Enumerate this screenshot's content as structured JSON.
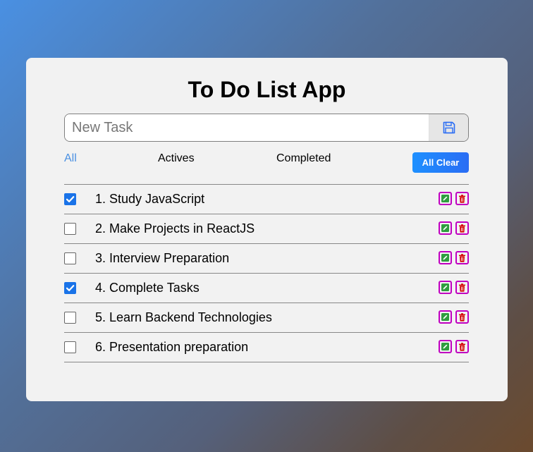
{
  "app": {
    "title": "To Do List App"
  },
  "new_task": {
    "placeholder": "New Task",
    "value": "",
    "save_icon": "floppy-disk-icon"
  },
  "filters": {
    "all": "All",
    "actives": "Actives",
    "completed": "Completed",
    "selected": "All",
    "clear_label": "All Clear"
  },
  "tasks": [
    {
      "label": "1. Study JavaScript",
      "done": true
    },
    {
      "label": "2. Make Projects in ReactJS",
      "done": false
    },
    {
      "label": "3. Interview Preparation",
      "done": false
    },
    {
      "label": "4. Complete Tasks",
      "done": true
    },
    {
      "label": "5. Learn Backend Technologies",
      "done": false
    },
    {
      "label": "6. Presentation preparation",
      "done": false
    }
  ],
  "icons": {
    "edit": "edit-icon",
    "delete": "trash-icon"
  },
  "colors": {
    "accent": "#1a73e8",
    "filter_active": "#4a90e2",
    "action_border": "#c000c0",
    "edit_green": "#2e9e3e",
    "delete_red": "#d40000"
  }
}
